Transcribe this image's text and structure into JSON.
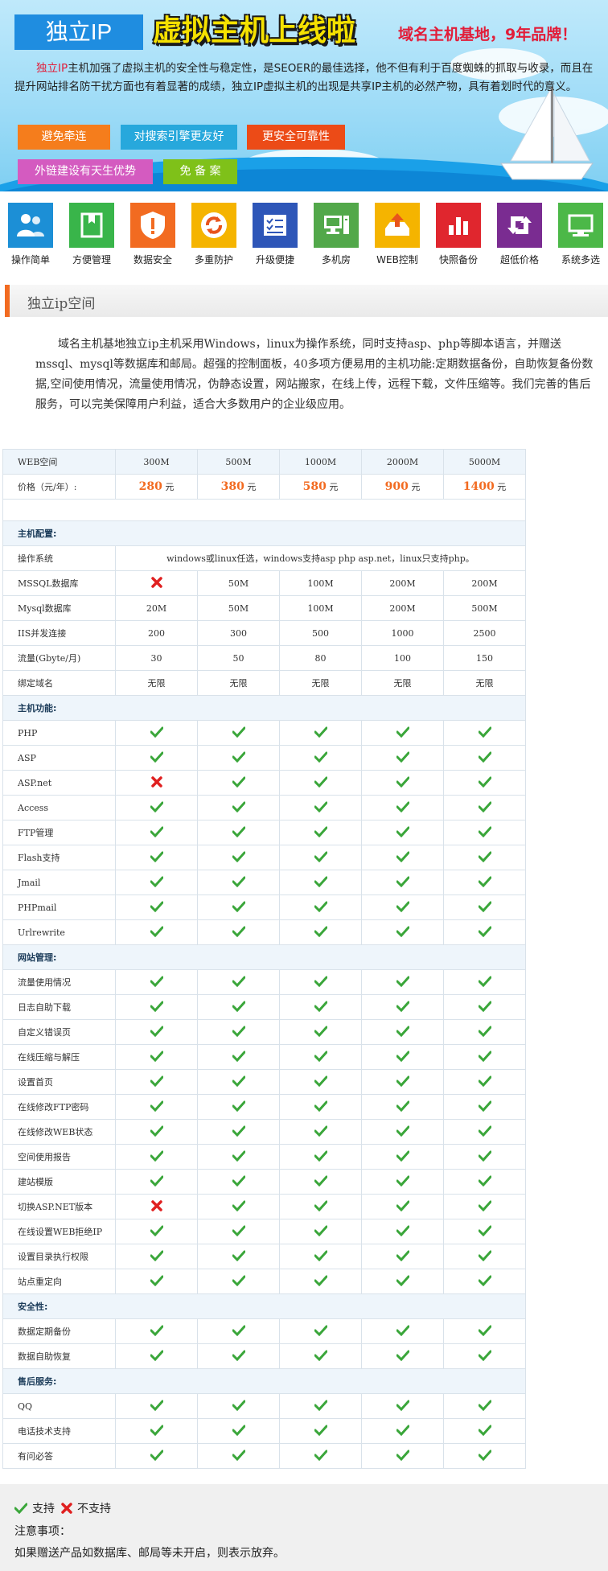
{
  "banner": {
    "tag": "独立IP",
    "headline": "虚拟主机上线啦",
    "slogan": "域名主机基地，9年品牌！",
    "intro_highlight": "独立IP",
    "intro_text": "主机加强了虚拟主机的安全性与稳定性，是SEOER的最佳选择，他不但有利于百度蜘蛛的抓取与收录，而且在提升网站排名防干扰方面也有着显著的成绩，独立IP虚拟主机的出现是共享IP主机的必然产物，具有着划时代的意义。",
    "buttons": [
      "避免牵连",
      "对搜索引擎更友好",
      "更安全可靠性",
      "外链建设有天生优势",
      "免 备 案"
    ],
    "colors": {
      "tag": "#1f8de0",
      "headline": "#f5e100",
      "slogan": "#e21d39"
    }
  },
  "features": [
    {
      "label": "操作简单",
      "icon": "users-icon",
      "color": "#1c8fd6"
    },
    {
      "label": "方便管理",
      "icon": "book-icon",
      "color": "#39b54a"
    },
    {
      "label": "数据安全",
      "icon": "shield-icon",
      "color": "#f26b21"
    },
    {
      "label": "多重防护",
      "icon": "refresh-icon",
      "color": "#f5b400"
    },
    {
      "label": "升级便捷",
      "icon": "checklist-icon",
      "color": "#2e56b8"
    },
    {
      "label": "多机房",
      "icon": "server-icon",
      "color": "#52a84a"
    },
    {
      "label": "WEB控制",
      "icon": "upload-icon",
      "color": "#f5b400"
    },
    {
      "label": "快照备份",
      "icon": "bar-chart-icon",
      "color": "#e0262e"
    },
    {
      "label": "超低价格",
      "icon": "arrows-icon",
      "color": "#7a2c91"
    },
    {
      "label": "系统多选",
      "icon": "monitor-icon",
      "color": "#4cb848"
    }
  ],
  "section": {
    "title": "独立ip空间",
    "description": "域名主机基地独立ip主机采用Windows，linux为操作系统，同时支持asp、php等脚本语言，并赠送mssql、mysql等数据库和邮局。超强的控制面板，40多项方便易用的主机功能:定期数据备份，自助恢复备份数据,空间使用情况，流量使用情况，伪静态设置，网站搬家，在线上传，远程下载，文件压缩等。我们完善的售后服务，可以完美保障用户利益，适合大多数用户的企业级应用。"
  },
  "table": {
    "header_label": "WEB空间",
    "columns": [
      "300M",
      "500M",
      "1000M",
      "2000M",
      "5000M"
    ],
    "price_label": "价格（元/年）:",
    "prices": [
      "280",
      "380",
      "580",
      "900",
      "1400"
    ],
    "price_unit": "元",
    "sections": [
      {
        "title": "主机配置:",
        "rows": [
          {
            "label": "操作系统",
            "span": "windows或linux任选，windows支持asp php asp.net，linux只支持php。"
          },
          {
            "label": "MSSQL数据库",
            "values": [
              "no",
              "50M",
              "100M",
              "200M",
              "200M"
            ]
          },
          {
            "label": "Mysql数据库",
            "values": [
              "20M",
              "50M",
              "100M",
              "200M",
              "500M"
            ]
          },
          {
            "label": "IIS并发连接",
            "values": [
              "200",
              "300",
              "500",
              "1000",
              "2500"
            ]
          },
          {
            "label": "流量(Gbyte/月)",
            "values": [
              "30",
              "50",
              "80",
              "100",
              "150"
            ]
          },
          {
            "label": "绑定域名",
            "values": [
              "无限",
              "无限",
              "无限",
              "无限",
              "无限"
            ]
          }
        ]
      },
      {
        "title": "主机功能:",
        "rows": [
          {
            "label": "PHP",
            "values": [
              "yes",
              "yes",
              "yes",
              "yes",
              "yes"
            ]
          },
          {
            "label": "ASP",
            "values": [
              "yes",
              "yes",
              "yes",
              "yes",
              "yes"
            ]
          },
          {
            "label": "ASP.net",
            "values": [
              "no",
              "yes",
              "yes",
              "yes",
              "yes"
            ]
          },
          {
            "label": "Access",
            "values": [
              "yes",
              "yes",
              "yes",
              "yes",
              "yes"
            ]
          },
          {
            "label": "FTP管理",
            "values": [
              "yes",
              "yes",
              "yes",
              "yes",
              "yes"
            ]
          },
          {
            "label": "Flash支持",
            "values": [
              "yes",
              "yes",
              "yes",
              "yes",
              "yes"
            ]
          },
          {
            "label": "Jmail",
            "values": [
              "yes",
              "yes",
              "yes",
              "yes",
              "yes"
            ]
          },
          {
            "label": "PHPmail",
            "values": [
              "yes",
              "yes",
              "yes",
              "yes",
              "yes"
            ]
          },
          {
            "label": "Urlrewrite",
            "values": [
              "yes",
              "yes",
              "yes",
              "yes",
              "yes"
            ]
          }
        ]
      },
      {
        "title": "网站管理:",
        "rows": [
          {
            "label": "流量使用情况",
            "values": [
              "yes",
              "yes",
              "yes",
              "yes",
              "yes"
            ]
          },
          {
            "label": "日志自助下载",
            "values": [
              "yes",
              "yes",
              "yes",
              "yes",
              "yes"
            ]
          },
          {
            "label": "自定义错误页",
            "values": [
              "yes",
              "yes",
              "yes",
              "yes",
              "yes"
            ]
          },
          {
            "label": "在线压缩与解压",
            "values": [
              "yes",
              "yes",
              "yes",
              "yes",
              "yes"
            ]
          },
          {
            "label": "设置首页",
            "values": [
              "yes",
              "yes",
              "yes",
              "yes",
              "yes"
            ]
          },
          {
            "label": "在线修改FTP密码",
            "values": [
              "yes",
              "yes",
              "yes",
              "yes",
              "yes"
            ]
          },
          {
            "label": "在线修改WEB状态",
            "values": [
              "yes",
              "yes",
              "yes",
              "yes",
              "yes"
            ]
          },
          {
            "label": "空间使用报告",
            "values": [
              "yes",
              "yes",
              "yes",
              "yes",
              "yes"
            ]
          },
          {
            "label": "建站模版",
            "values": [
              "yes",
              "yes",
              "yes",
              "yes",
              "yes"
            ]
          },
          {
            "label": "切换ASP.NET版本",
            "values": [
              "no",
              "yes",
              "yes",
              "yes",
              "yes"
            ]
          },
          {
            "label": "在线设置WEB拒绝IP",
            "values": [
              "yes",
              "yes",
              "yes",
              "yes",
              "yes"
            ]
          },
          {
            "label": "设置目录执行权限",
            "values": [
              "yes",
              "yes",
              "yes",
              "yes",
              "yes"
            ]
          },
          {
            "label": "站点重定向",
            "values": [
              "yes",
              "yes",
              "yes",
              "yes",
              "yes"
            ]
          }
        ]
      },
      {
        "title": "安全性:",
        "rows": [
          {
            "label": "数据定期备份",
            "values": [
              "yes",
              "yes",
              "yes",
              "yes",
              "yes"
            ]
          },
          {
            "label": "数据自助恢复",
            "values": [
              "yes",
              "yes",
              "yes",
              "yes",
              "yes"
            ]
          }
        ]
      },
      {
        "title": "售后服务:",
        "rows": [
          {
            "label": "QQ",
            "values": [
              "yes",
              "yes",
              "yes",
              "yes",
              "yes"
            ]
          },
          {
            "label": "电话技术支持",
            "values": [
              "yes",
              "yes",
              "yes",
              "yes",
              "yes"
            ]
          },
          {
            "label": "有问必答",
            "values": [
              "yes",
              "yes",
              "yes",
              "yes",
              "yes"
            ]
          }
        ]
      }
    ]
  },
  "footer": {
    "legend_yes": "支持",
    "legend_no": "不支持",
    "note_title": "注意事项：",
    "note_text": "如果赠送产品如数据库、邮局等未开启，则表示放弃。"
  }
}
